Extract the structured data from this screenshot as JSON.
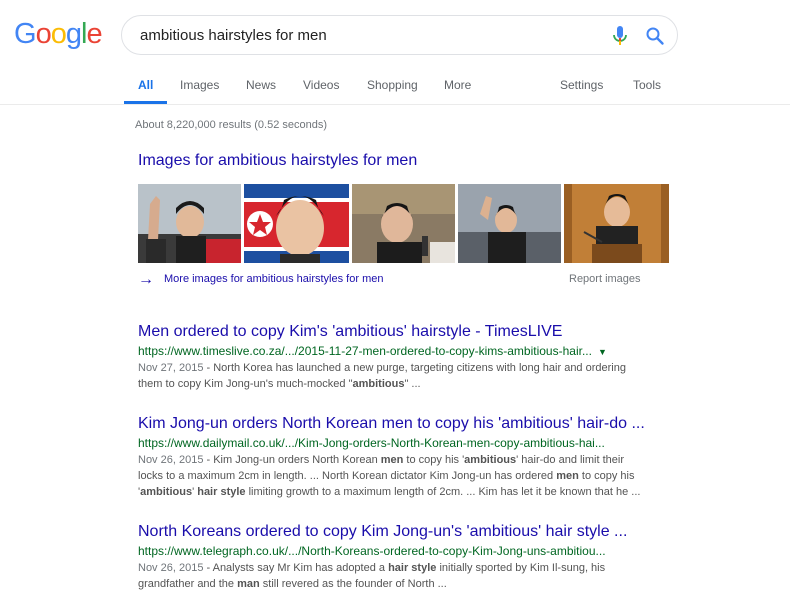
{
  "logo": {
    "letters": [
      "G",
      "o",
      "o",
      "g",
      "l",
      "e"
    ]
  },
  "search": {
    "query": "ambitious hairstyles for men"
  },
  "tabs": {
    "all": "All",
    "images": "Images",
    "news": "News",
    "videos": "Videos",
    "shopping": "Shopping",
    "more": "More",
    "settings": "Settings",
    "tools": "Tools"
  },
  "stats": "About 8,220,000 results (0.52 seconds)",
  "image_pack": {
    "heading": "Images for ambitious hairstyles for men",
    "more_link": "More images for ambitious hairstyles for men",
    "report": "Report images"
  },
  "results": [
    {
      "title": "Men ordered to copy Kim's 'ambitious' hairstyle - TimesLIVE",
      "url": "https://www.timeslive.co.za/.../2015-11-27-men-ordered-to-copy-kims-ambitious-hair...",
      "date": "Nov 27, 2015",
      "snippet_l1": " - North Korea has launched a new purge, targeting citizens with long hair and ordering",
      "snippet_l2a": "them to copy Kim Jong-un's much-mocked \"",
      "snippet_l2b": "ambitious",
      "snippet_l2c": "\" ..."
    },
    {
      "title": "Kim Jong-un orders North Korean men to copy his 'ambitious' hair-do ...",
      "url": "https://www.dailymail.co.uk/.../Kim-Jong-orders-North-Korean-men-copy-ambitious-hai...",
      "date": "Nov 26, 2015",
      "s1a": " - Kim Jong-un orders North Korean ",
      "s1b": "men",
      "s1c": " to copy his '",
      "s1d": "ambitious",
      "s1e": "' hair-do and limit their",
      "s2a": "locks to a maximum 2cm in length. ... North Korean dictator Kim Jong-un has ordered ",
      "s2b": "men",
      "s2c": " to copy his",
      "s3a": "'",
      "s3b": "ambitious",
      "s3c": "' ",
      "s3d": "hair style",
      "s3e": " limiting growth to a maximum length of 2cm. ... Kim has let it be known that he ..."
    },
    {
      "title": "North Koreans ordered to copy Kim Jong-un's 'ambitious' hair style ...",
      "url": "https://www.telegraph.co.uk/.../North-Koreans-ordered-to-copy-Kim-Jong-uns-ambitiou...",
      "date": "Nov 26, 2015",
      "s1a": " - Analysts say Mr Kim has adopted a ",
      "s1b": "hair style",
      "s1c": " initially sported by Kim Il-sung, his",
      "s2a": "grandfather and the ",
      "s2b": "man",
      "s2c": " still revered as the founder of North ..."
    }
  ],
  "colors": {
    "link": "#1a0dab",
    "url": "#006621",
    "accent": "#1a73e8",
    "blue": "#4285F4",
    "red": "#EA4335",
    "yellow": "#FBBC05",
    "green": "#34A853"
  }
}
